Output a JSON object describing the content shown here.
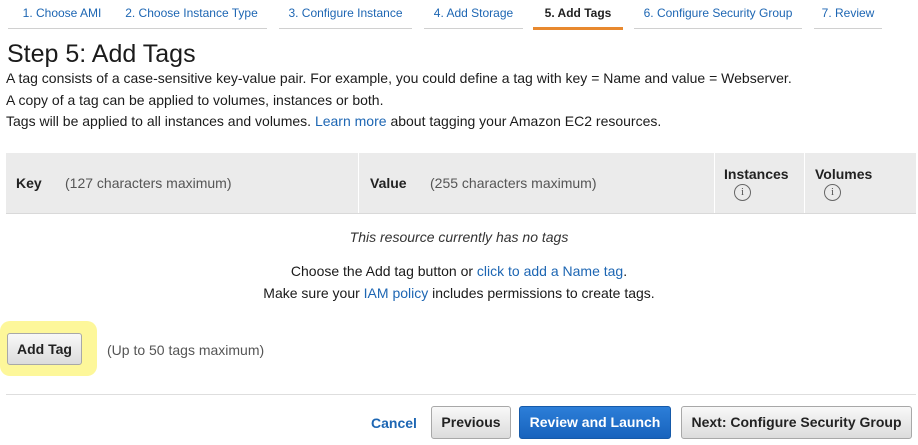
{
  "wizard": {
    "steps": [
      {
        "label": "1. Choose AMI"
      },
      {
        "label": "2. Choose Instance Type"
      },
      {
        "label": "3. Configure Instance"
      },
      {
        "label": "4. Add Storage"
      },
      {
        "label": "5. Add Tags"
      },
      {
        "label": "6. Configure Security Group"
      },
      {
        "label": "7. Review"
      }
    ],
    "active_step": 4
  },
  "page": {
    "title": "Step 5: Add Tags",
    "line1": "A tag consists of a case-sensitive key-value pair. For example, you could define a tag with key = Name and value = Webserver.",
    "line2": "A copy of a tag can be applied to volumes, instances or both.",
    "line3_pre": "Tags will be applied to all instances and volumes.",
    "line3_link": "Learn more",
    "line3_post": "about tagging your Amazon EC2 resources."
  },
  "table": {
    "key_label": "Key",
    "key_hint": "(127 characters maximum)",
    "value_label": "Value",
    "value_hint": "(255 characters maximum)",
    "instances_label": "Instances",
    "volumes_label": "Volumes",
    "info_glyph": "i"
  },
  "empty_state": {
    "message": "This resource currently has no tags",
    "line1_pre": "Choose the Add tag button or",
    "line1_link": "click to add a Name tag",
    "line1_post": ".",
    "line2_pre": "Make sure your",
    "line2_link": "IAM policy",
    "line2_post": "includes permissions to create tags."
  },
  "actions": {
    "add_tag": "Add Tag",
    "limit_text": "(Up to 50 tags maximum)",
    "cancel": "Cancel",
    "previous": "Previous",
    "review_launch": "Review and Launch",
    "next": "Next: Configure Security Group"
  },
  "colors": {
    "link": "#1d66b3",
    "active_tab_underline": "#e8892f",
    "primary_button": "#1e6fca",
    "highlight": "#fdf79a"
  }
}
